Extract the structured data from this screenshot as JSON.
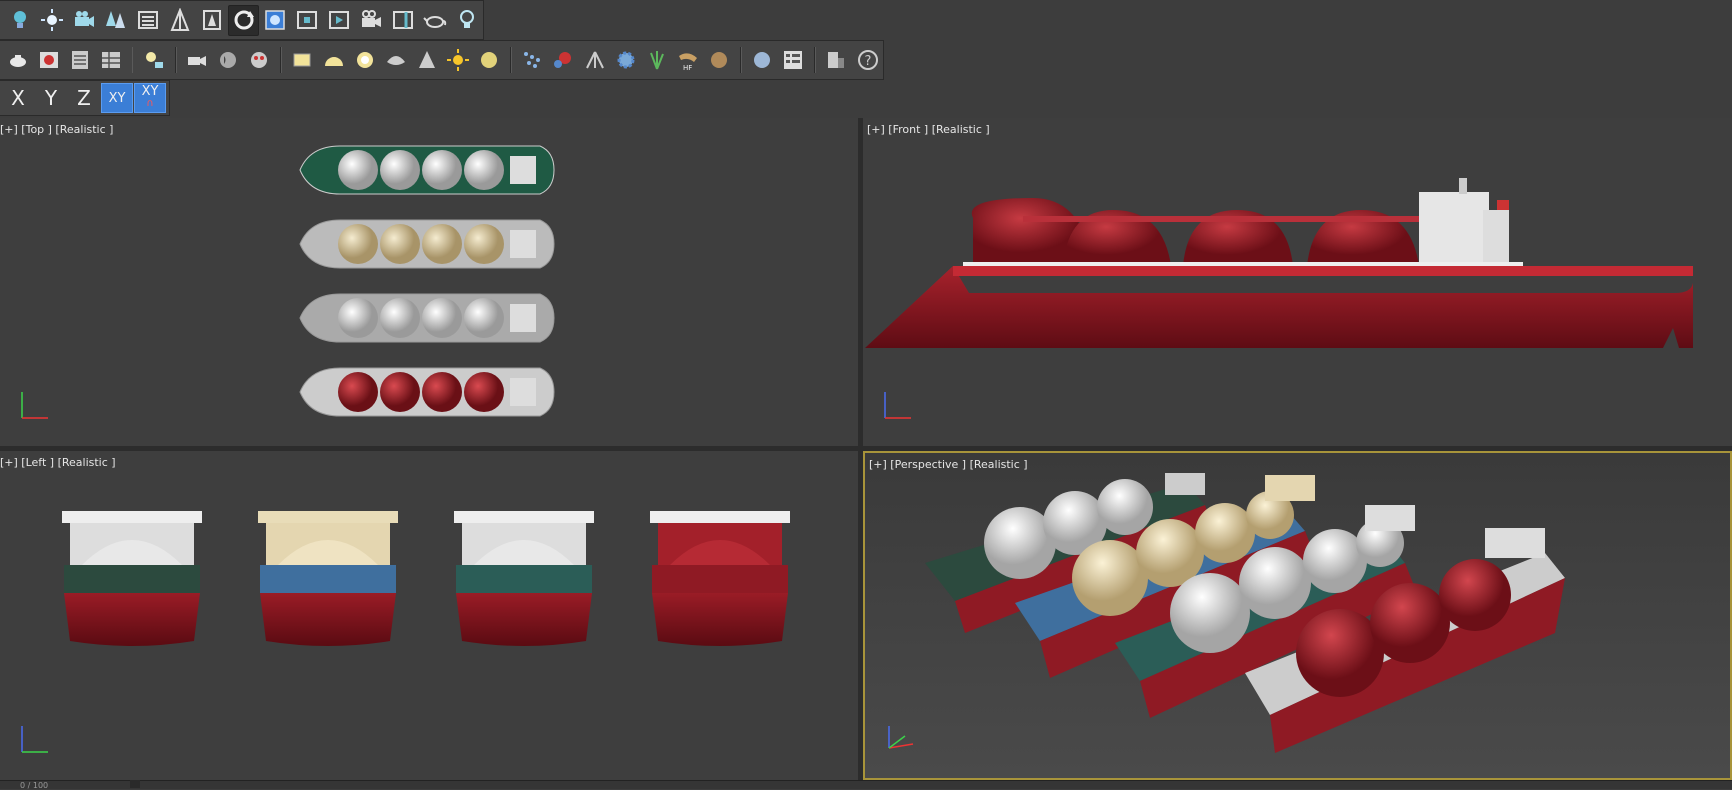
{
  "toolbar_main": {
    "icons": [
      "bulb-icon",
      "sun-icon",
      "camera-group-icon",
      "trees-icon",
      "list-icon",
      "rule-icon",
      "figure-icon",
      "rotate-icon",
      "layer-icon",
      "frame-icon",
      "render-frame-icon",
      "film-camera-icon",
      "panel-icon",
      "teapot-icon",
      "lightbulb-outline-icon"
    ]
  },
  "toolbar_secondary": {
    "icons": [
      "teapot-icon",
      "render-image-icon",
      "table-icon",
      "grid-table-icon",
      "light-spot-icon",
      "video-camera-icon",
      "sound-icon",
      "mask-icon",
      "box-icon",
      "dome-icon",
      "sphere-ring-icon",
      "shell-icon",
      "cone-icon",
      "sun-icon",
      "disc-icon",
      "particles-icon",
      "spheres-icon",
      "tripod-icon",
      "gear-icon",
      "grass-icon",
      "hair-icon",
      "fur-icon",
      "sphere-icon",
      "checklist-icon",
      "chart-page-icon",
      "help-icon"
    ]
  },
  "axis_constraints": {
    "buttons": [
      {
        "label": "X",
        "active": false
      },
      {
        "label": "Y",
        "active": false
      },
      {
        "label": "Z",
        "active": false
      },
      {
        "label": "XY",
        "active": true
      },
      {
        "label": "XY",
        "active": true,
        "locked": true
      }
    ]
  },
  "viewports": {
    "top": {
      "label": "[+] [Top ] [Realistic ]"
    },
    "front": {
      "label": "[+] [Front ] [Realistic ]"
    },
    "left": {
      "label": "[+] [Left ] [Realistic ]"
    },
    "perspective": {
      "label": "[+] [Perspective ] [Realistic ]"
    }
  },
  "status": {
    "frame_text": "0 / 100"
  },
  "colors": {
    "hull_red": "#8f1a24",
    "tank_white": "#e8e8e8",
    "tank_cream": "#e4d6b0",
    "tank_red": "#a3202a",
    "band_green": "#2c4a3e",
    "band_blue": "#3f6f9e",
    "band_teal": "#2b5d57",
    "active_viewport_border": "#a8943a",
    "axis_active": "#3b7ed6"
  }
}
